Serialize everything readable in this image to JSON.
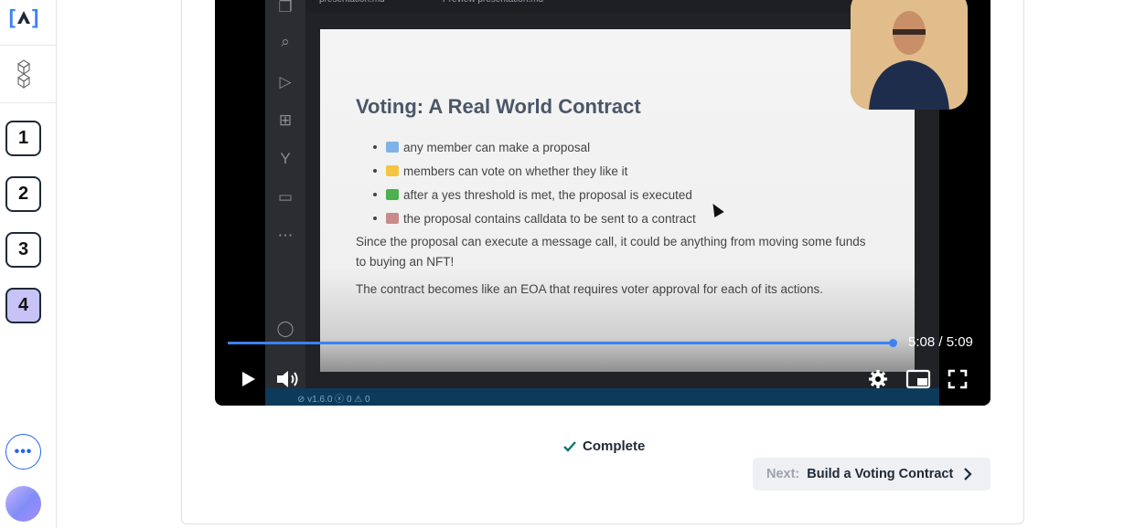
{
  "sidebar": {
    "logo_text": "A",
    "steps": [
      "1",
      "2",
      "3",
      "4"
    ],
    "active_step": "4",
    "more_label": "•••"
  },
  "video": {
    "tabs": [
      "presentation.md",
      "Preview presentation.md"
    ],
    "slide": {
      "title": "Voting: A Real World Contract",
      "bullets": [
        "any member can make a proposal",
        "members can vote on whether they like it",
        "after a yes threshold is met, the proposal is executed",
        "the proposal contains calldata to be sent to a contract"
      ],
      "paragraph1": "Since the proposal can execute a message call, it could be anything from moving some funds to buying an NFT!",
      "paragraph2": "The contract becomes like an EOA that requires voter approval for each of its actions."
    },
    "status_text": "⊘ v1.6.0  ⓧ 0 ⚠ 0",
    "time": "5:08 / 5:09",
    "progress": 0.997
  },
  "complete_label": "Complete",
  "next": {
    "prefix": "Next:",
    "label": "Build a Voting Contract"
  },
  "colors": {
    "accent": "#3b82f6",
    "active_step_bg": "#c7c3f7",
    "check": "#0f766e"
  }
}
